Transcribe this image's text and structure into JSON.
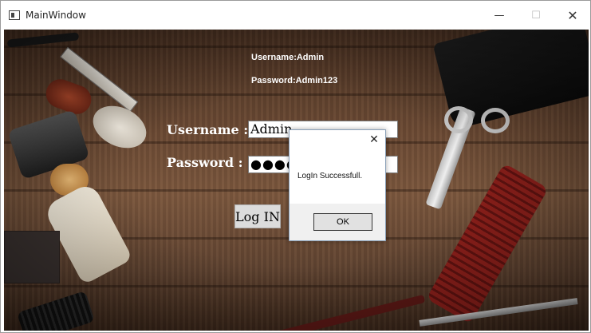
{
  "window": {
    "title": "MainWindow",
    "controls": {
      "minimize": "—",
      "maximize": "☐",
      "close": "✕"
    }
  },
  "hints": {
    "username": "Username:Admin",
    "password": "Password:Admin123"
  },
  "form": {
    "username_label": "Username :",
    "username_value": "Admin",
    "password_label": "Password :",
    "password_value": "●●●●●●●●●●",
    "login_button": "Log IN"
  },
  "dialog": {
    "close_glyph": "✕",
    "message": "LogIn Successfull.",
    "ok_button": "OK"
  }
}
